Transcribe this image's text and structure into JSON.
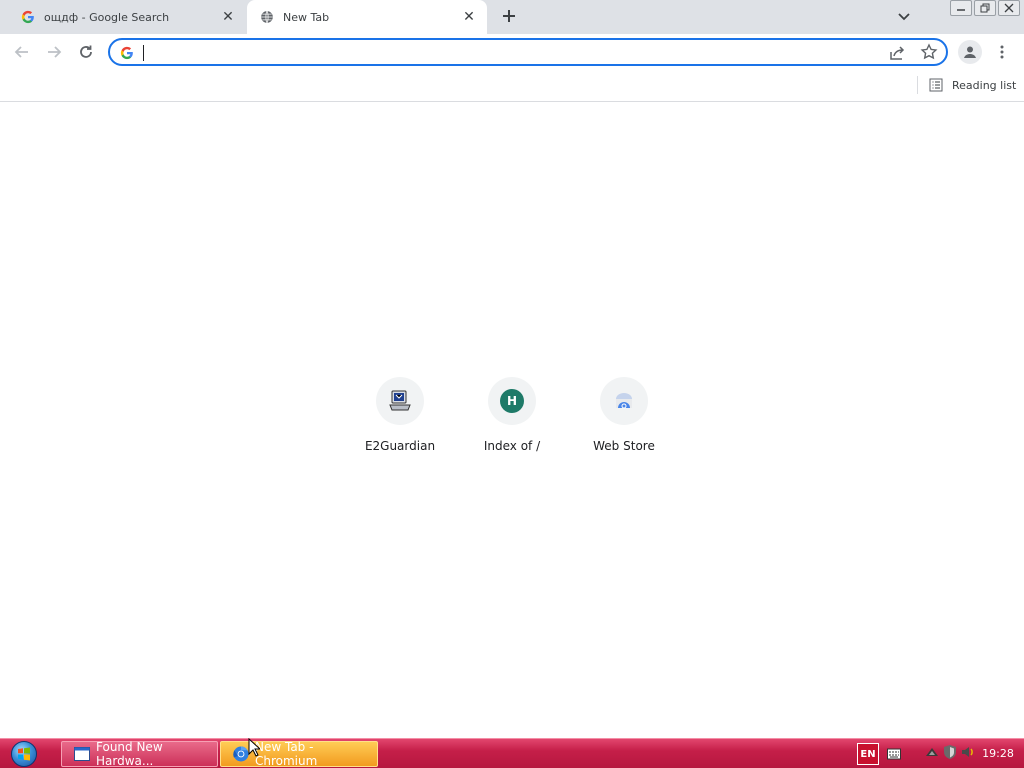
{
  "tabs": [
    {
      "title": "ощдф - Google Search",
      "favicon": "google-g-icon",
      "active": false
    },
    {
      "title": "New Tab",
      "favicon": "globe-icon",
      "active": true
    }
  ],
  "toolbar": {
    "omnibox_value": "",
    "omnibox_icon": "google-g-icon"
  },
  "bookmarks": {
    "reading_list_label": "Reading list"
  },
  "ntp": {
    "shortcuts": [
      {
        "label": "E2Guardian",
        "icon": "computer-icon"
      },
      {
        "label": "Index of /",
        "icon": "letter-h-icon",
        "badge": "H"
      },
      {
        "label": "Web Store",
        "icon": "web-store-icon"
      }
    ]
  },
  "taskbar": {
    "tasks": [
      {
        "label": "Found New Hardwa...",
        "icon": "window-icon"
      },
      {
        "label": "New Tab - Chromium",
        "icon": "chromium-icon"
      }
    ],
    "language": "EN",
    "clock": "19:28"
  },
  "colors": {
    "accent": "#1a73e8",
    "tabstrip": "#dee1e6",
    "taskbar": "#c51f49"
  }
}
